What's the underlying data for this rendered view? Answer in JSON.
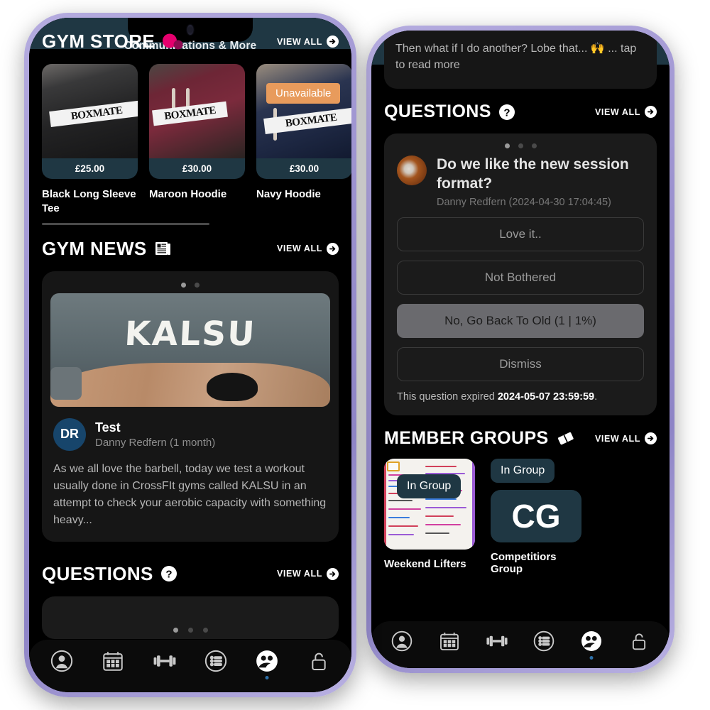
{
  "app": {
    "header_title": "Communications & More",
    "accent_pink": "#e6006e",
    "accent_teal": "#1f3743",
    "accent_orange": "#e89b5c",
    "bezel": "#a9a0d8"
  },
  "view_all_label": "VIEW ALL",
  "left_phone": {
    "sections": {
      "store": {
        "title": "GYM STORE",
        "icon": "pink-circles-icon",
        "products": [
          {
            "name": "Black Long Sleeve Tee",
            "price": "£25.00",
            "print": "BOXMATE",
            "badge": ""
          },
          {
            "name": "Maroon Hoodie",
            "price": "£30.00",
            "print": "BOXMATE",
            "badge": ""
          },
          {
            "name": "Navy Hoodie",
            "price": "£30.00",
            "print": "BOXMATE",
            "badge": "Unavailable"
          }
        ]
      },
      "news": {
        "title": "GYM NEWS",
        "icon": "newspaper-icon",
        "carousel_dots": 2,
        "carousel_active": 0,
        "article": {
          "image_text": "KALSU",
          "avatar_initials": "DR",
          "title": "Test",
          "meta": "Danny Redfern (1 month)",
          "body": "As we all love the barbell, today we test a workout usually done in CrossFIt gyms called KALSU in an attempt to check your aerobic capacity with something heavy..."
        }
      },
      "questions": {
        "title": "QUESTIONS",
        "icon": "question-mark-icon",
        "carousel_dots": 3,
        "carousel_active": 0
      }
    },
    "nav": [
      {
        "name": "profile-icon",
        "active": false
      },
      {
        "name": "calendar-icon",
        "active": false
      },
      {
        "name": "dumbbell-icon",
        "active": false
      },
      {
        "name": "list-icon",
        "active": false
      },
      {
        "name": "people-icon",
        "active": true
      },
      {
        "name": "unlock-icon",
        "active": false
      }
    ]
  },
  "right_phone": {
    "snippet": "Then what if I do another? Lobe that... 🙌 ... tap to read more",
    "sections": {
      "questions": {
        "title": "QUESTIONS",
        "icon": "question-mark-icon",
        "carousel_dots": 3,
        "carousel_active": 0,
        "card": {
          "title": "Do we like the new session format?",
          "meta": "Danny Redfern (2024-04-30 17:04:45)",
          "options": [
            {
              "label": "Love it..",
              "selected": false
            },
            {
              "label": "Not Bothered",
              "selected": false
            },
            {
              "label": "No, Go Back To Old (1 | 1%)",
              "selected": true
            },
            {
              "label": "Dismiss",
              "selected": false
            }
          ],
          "expiry_prefix": "This question expired ",
          "expiry_date": "2024-05-07 23:59:59",
          "expiry_suffix": "."
        }
      },
      "member_groups": {
        "title": "MEMBER GROUPS",
        "icon": "ticket-icon",
        "groups": [
          {
            "name": "Weekend Lifters",
            "badge": "In Group",
            "thumb_type": "photo",
            "initials": ""
          },
          {
            "name": "Competitiors Group",
            "badge": "In Group",
            "thumb_type": "initials",
            "initials": "CG"
          }
        ]
      }
    },
    "nav": [
      {
        "name": "profile-icon",
        "active": false
      },
      {
        "name": "calendar-icon",
        "active": false
      },
      {
        "name": "dumbbell-icon",
        "active": false
      },
      {
        "name": "list-icon",
        "active": false
      },
      {
        "name": "people-icon",
        "active": true
      },
      {
        "name": "unlock-icon",
        "active": false
      }
    ]
  }
}
